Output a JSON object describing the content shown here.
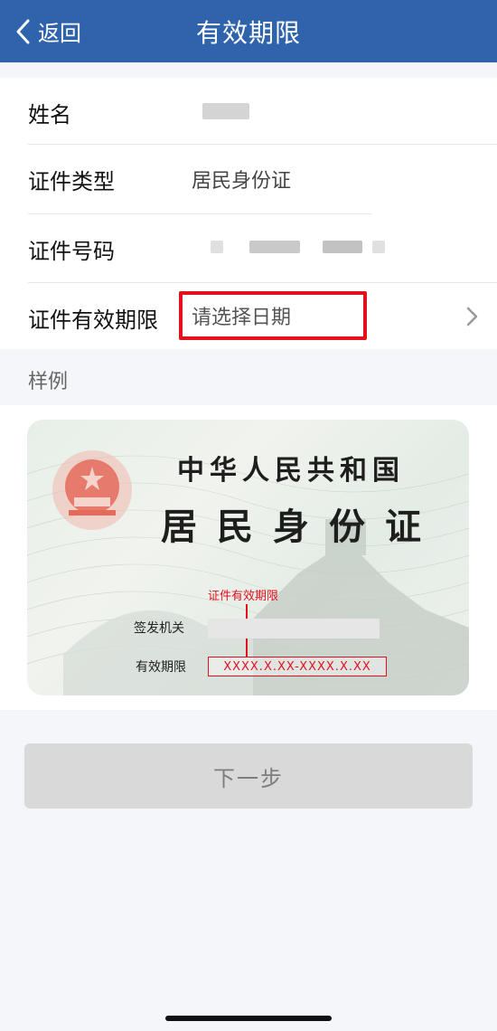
{
  "header": {
    "back_label": "返回",
    "title": "有效期限"
  },
  "form": {
    "rows": [
      {
        "label": "姓名",
        "value": ""
      },
      {
        "label": "证件类型",
        "value": "居民身份证"
      },
      {
        "label": "证件号码",
        "value": ""
      },
      {
        "label": "证件有效期限",
        "placeholder": "请选择日期"
      }
    ]
  },
  "sample": {
    "label": "样例",
    "card": {
      "line1": "中华人民共和国",
      "line2": "居民身份证",
      "annotation": "证件有效期限",
      "issuer_label": "签发机关",
      "validity_label": "有效期限",
      "validity_format": "XXXX.X.XX-XXXX.X.XX"
    }
  },
  "next_button": {
    "label": "下一步",
    "enabled": false
  },
  "colors": {
    "header_bg": "#2f64ad",
    "highlight": "#e3101e",
    "disabled_button": "#d9d9d9"
  }
}
